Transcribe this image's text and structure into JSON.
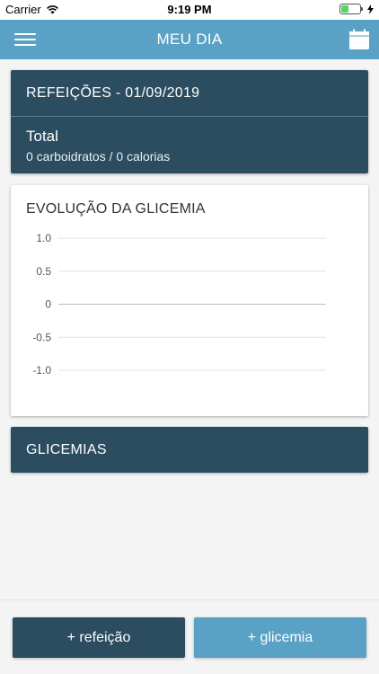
{
  "status_bar": {
    "carrier": "Carrier",
    "time": "9:19 PM"
  },
  "nav": {
    "title": "MEU DIA",
    "menu_icon": "hamburger-menu-icon",
    "calendar_icon": "calendar-icon"
  },
  "meals": {
    "header": "REFEIÇÕES - 01/09/2019",
    "total_label": "Total",
    "total_values": "0 carboidratos / 0 calorias"
  },
  "glucose_chart": {
    "title": "EVOLUÇÃO DA GLICEMIA"
  },
  "chart_data": {
    "type": "line",
    "title": "EVOLUÇÃO DA GLICEMIA",
    "xlabel": "",
    "ylabel": "",
    "y_ticks": [
      "1.0",
      "0.5",
      "0",
      "-0.5",
      "-1.0"
    ],
    "ylim": [
      -1.0,
      1.0
    ],
    "series": [],
    "grid": true
  },
  "glucose_list": {
    "header": "GLICEMIAS"
  },
  "actions": {
    "add_meal": "+ refeição",
    "add_glucose": "+ glicemia"
  },
  "colors": {
    "primary_dark": "#2c4d60",
    "primary_light": "#5aa2c5",
    "background": "#f4f4f4"
  }
}
